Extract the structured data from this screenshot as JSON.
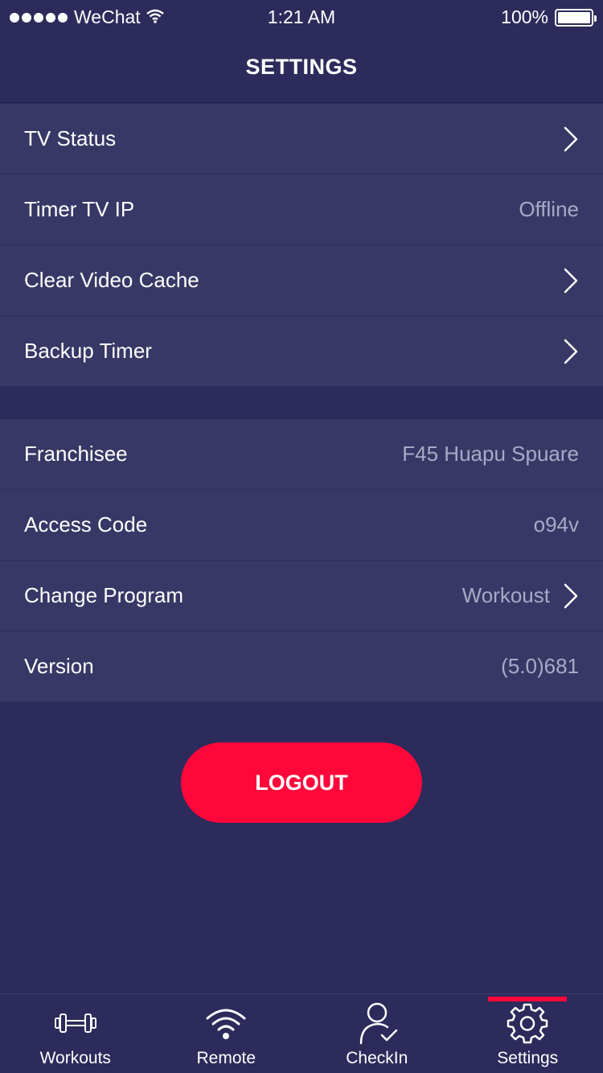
{
  "status_bar": {
    "carrier": "WeChat",
    "time": "1:21 AM",
    "battery": "100%",
    "battery_level": 1.0
  },
  "header": {
    "title": "SETTINGS"
  },
  "group1": [
    {
      "label": "TV Status",
      "value": "",
      "chevron": true
    },
    {
      "label": "Timer TV IP",
      "value": "Offline",
      "chevron": false
    },
    {
      "label": "Clear Video Cache",
      "value": "",
      "chevron": true
    },
    {
      "label": "Backup Timer",
      "value": "",
      "chevron": true
    }
  ],
  "group2": [
    {
      "label": "Franchisee",
      "value": "F45 Huapu Spuare",
      "chevron": false
    },
    {
      "label": "Access Code",
      "value": "o94v",
      "chevron": false
    },
    {
      "label": "Change Program",
      "value": "Workoust",
      "chevron": true
    },
    {
      "label": "Version",
      "value": "(5.0)681",
      "chevron": false
    }
  ],
  "logout": {
    "label": "LOGOUT"
  },
  "tabs": [
    {
      "label": "Workouts",
      "icon": "dumbbell-icon",
      "active": false
    },
    {
      "label": "Remote",
      "icon": "wifi-icon",
      "active": false
    },
    {
      "label": "CheckIn",
      "icon": "user-check-icon",
      "active": false
    },
    {
      "label": "Settings",
      "icon": "gear-icon",
      "active": true
    }
  ],
  "colors": {
    "background": "#2c2b5b",
    "row_background": "#383866",
    "accent": "#ff073a",
    "secondary_text": "#a9a9c7"
  }
}
